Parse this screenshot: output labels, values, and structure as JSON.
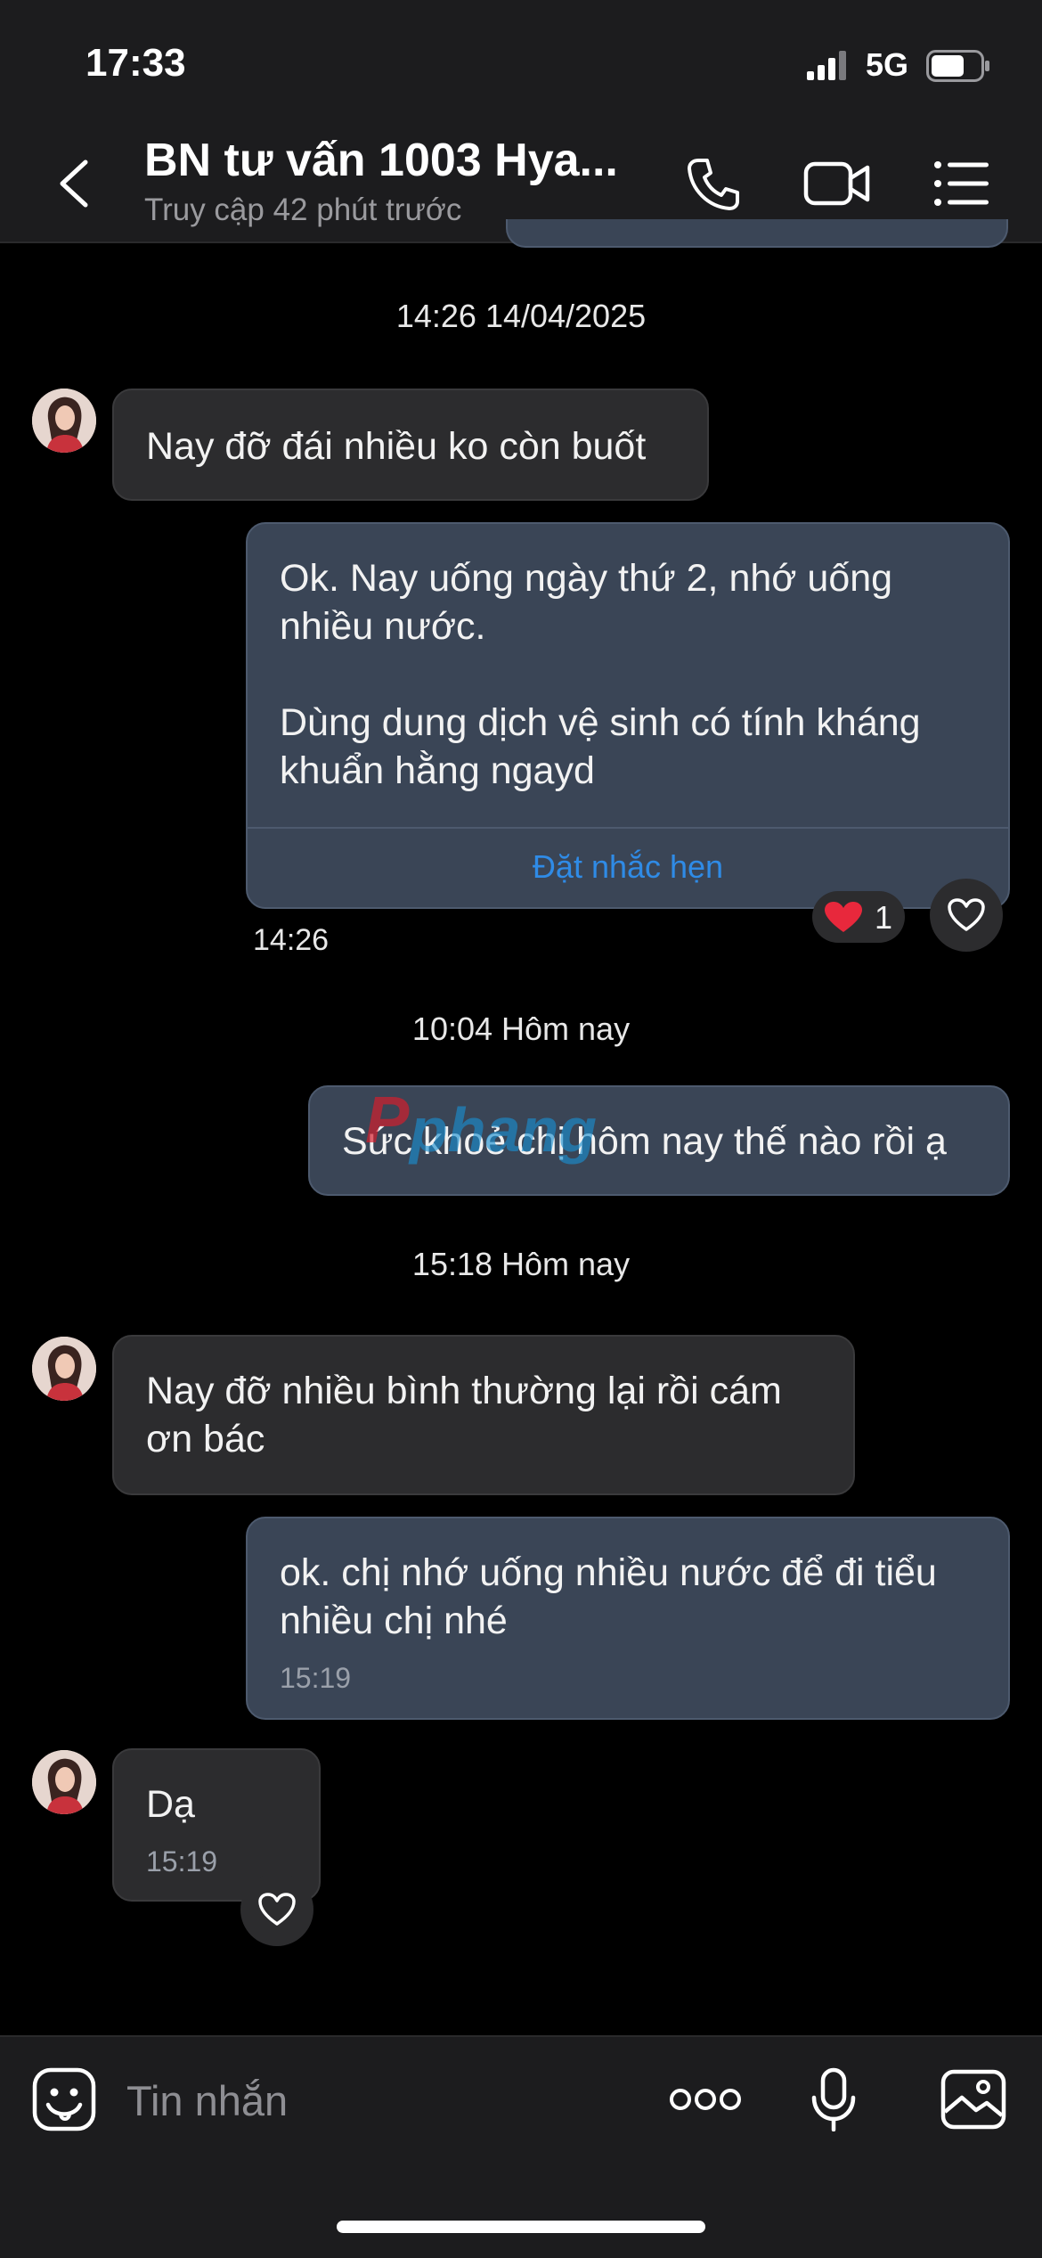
{
  "status_bar": {
    "time": "17:33",
    "network": "5G"
  },
  "header": {
    "title": "BN tư vấn 1003 Hya...",
    "subtitle": "Truy cập 42 phút trước"
  },
  "messages": [
    {
      "type": "timestamp",
      "text": "14:26 14/04/2025"
    },
    {
      "type": "incoming",
      "text": "Nay đỡ đái nhiều ko còn buốt"
    },
    {
      "type": "outgoing",
      "lines": [
        "Ok. Nay uống ngày thứ 2, nhớ uống",
        "nhiều nước.",
        "Dùng dung dịch vệ sinh có tính kháng",
        "khuẩn hằng ngayd"
      ],
      "action": "Đặt nhắc hẹn",
      "time": "14:26",
      "reaction_count": "1"
    },
    {
      "type": "timestamp",
      "text": "10:04 Hôm nay"
    },
    {
      "type": "outgoing",
      "text": "Sức khoẻ chị hôm nay thế nào rồi ạ"
    },
    {
      "type": "timestamp",
      "text": "15:18 Hôm nay"
    },
    {
      "type": "incoming",
      "lines": [
        "Nay đỡ nhiều bình thường lại rồi cám",
        "ơn bác"
      ]
    },
    {
      "type": "outgoing",
      "lines": [
        "ok. chị nhớ uống nhiều nước để đi tiểu",
        "nhiều chị nhé"
      ],
      "time": "15:19"
    },
    {
      "type": "incoming",
      "text": "Dạ",
      "time": "15:19"
    }
  ],
  "composer": {
    "placeholder": "Tin nhắn"
  },
  "watermark": "Pphang",
  "icons": [
    "back-chevron-icon",
    "phone-icon",
    "video-call-icon",
    "menu-list-icon",
    "emoji-icon",
    "more-dots-icon",
    "microphone-icon",
    "image-icon",
    "heart-icon"
  ],
  "colors": {
    "background": "#000000",
    "header": "#1c1c1e",
    "incoming_bubble": "#2c2c2e",
    "outgoing_bubble": "#3a4556",
    "link": "#2f8be6",
    "heart": "#e8283c"
  }
}
